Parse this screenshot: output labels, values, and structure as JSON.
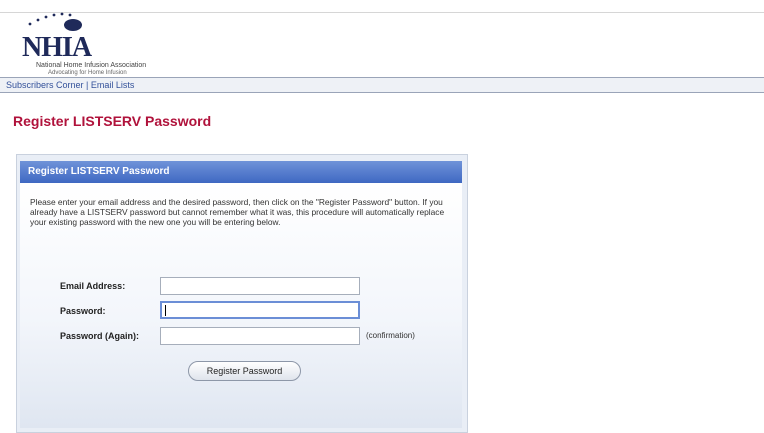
{
  "header": {
    "logo_text": "NHIA",
    "logo_subtitle": "National Home Infusion Association",
    "logo_tagline": "Advocating for Home Infusion"
  },
  "nav": {
    "items": [
      {
        "label": "Subscribers Corner"
      },
      {
        "label": "Email Lists"
      }
    ]
  },
  "page": {
    "title": "Register LISTSERV Password"
  },
  "panel": {
    "title": "Register LISTSERV Password",
    "intro": "Please enter your email address and the desired password, then click on the \"Register Password\" button. If you already have a LISTSERV password but cannot remember what it was, this procedure will automatically replace your existing password with the new one you will be entering below.",
    "fields": {
      "email_label": "Email Address:",
      "email_value": "",
      "password_label": "Password:",
      "password_value": "",
      "password_again_label": "Password (Again):",
      "password_again_value": "",
      "password_again_hint": "(confirmation)"
    },
    "submit_label": "Register Password"
  }
}
